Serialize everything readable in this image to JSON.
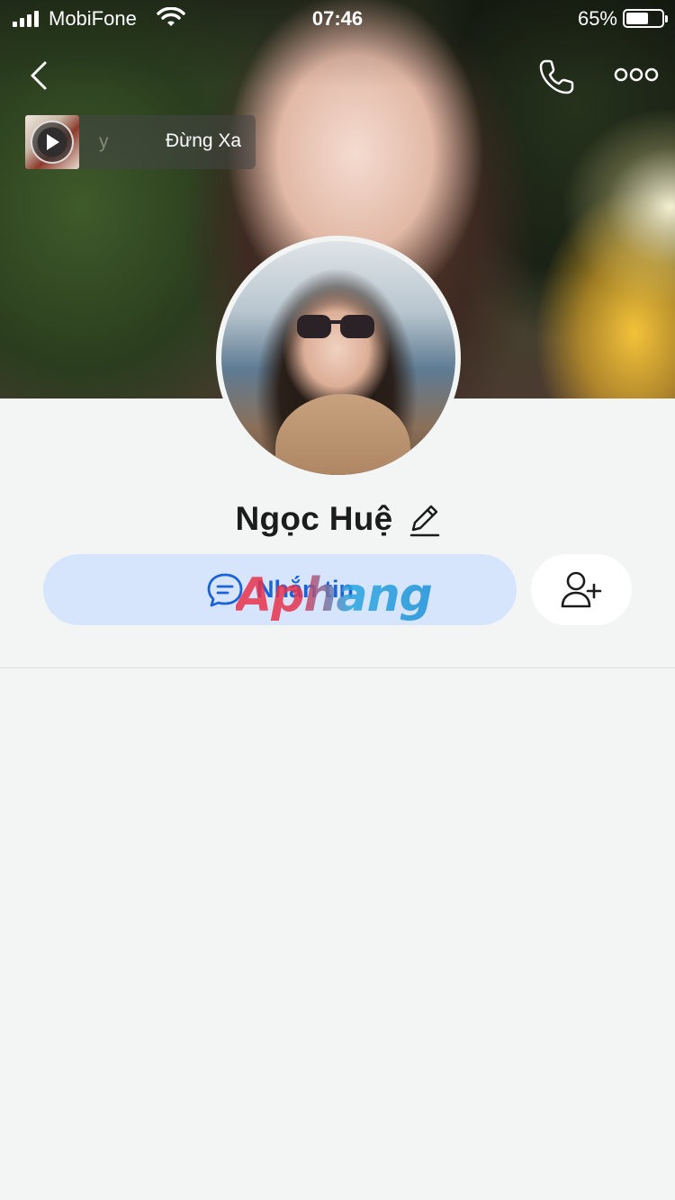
{
  "status_bar": {
    "carrier": "MobiFone",
    "time": "07:46",
    "battery_percent": "65%"
  },
  "header": {
    "back_icon": "back-chevron-icon",
    "call_icon": "phone-icon",
    "more_icon": "more-dots-icon"
  },
  "music": {
    "subtitle": "y",
    "title": "Đừng Xa",
    "play_icon": "play-icon"
  },
  "profile": {
    "name": "Ngọc Huệ",
    "edit_icon": "pencil-icon"
  },
  "actions": {
    "message_label": "Nhắn tin",
    "message_icon": "chat-bubble-icon",
    "add_friend_icon": "add-user-icon"
  },
  "watermark": "Aphang",
  "colors": {
    "message_bg": "#d6e5fb",
    "message_text": "#1a62d8",
    "page_bg": "#f3f4f4"
  }
}
